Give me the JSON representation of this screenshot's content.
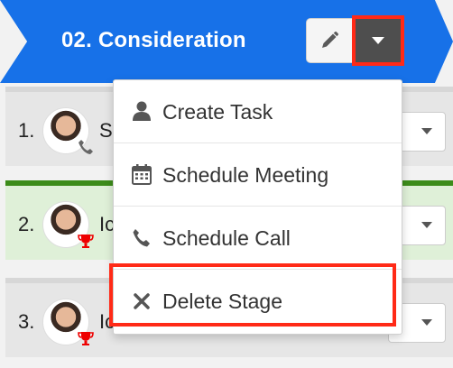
{
  "stage": {
    "title": "02. Consideration",
    "edit_icon": "pencil-icon",
    "menu_icon": "caret-down-icon"
  },
  "menu": {
    "items": [
      {
        "label": "Create Task",
        "icon": "user-icon"
      },
      {
        "label": "Schedule Meeting",
        "icon": "calendar-icon"
      },
      {
        "label": "Schedule Call",
        "icon": "phone-icon"
      },
      {
        "label": "Delete Stage",
        "icon": "close-icon"
      }
    ]
  },
  "rows": [
    {
      "number": "1.",
      "text": "S",
      "badge": "phone-icon",
      "state": "open"
    },
    {
      "number": "2.",
      "text": "Ic",
      "badge": "trophy-icon",
      "state": "done"
    },
    {
      "number": "3.",
      "text": "Ic",
      "badge": "trophy-icon",
      "state": "open"
    }
  ],
  "colors": {
    "stage_header": "#1771e8",
    "highlight": "#ff2a17",
    "done_row": "#dff0d8",
    "done_border": "#3c8c1a"
  }
}
